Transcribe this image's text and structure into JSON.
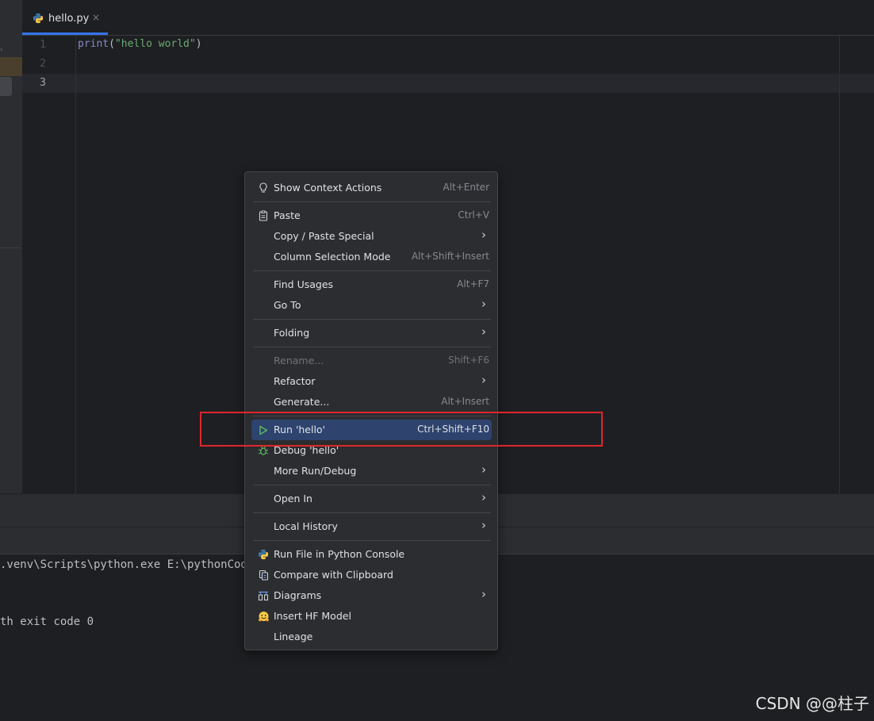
{
  "tab": {
    "filename": "hello.py",
    "close_glyph": "×"
  },
  "editor": {
    "line_numbers": [
      "1",
      "2",
      "3"
    ],
    "code": {
      "fn": "print",
      "open": "(",
      "str": "\"hello world\"",
      "close": ")"
    }
  },
  "console": {
    "line1": ".venv\\Scripts\\python.exe E:\\pythonCode",
    "line2": "th exit code 0"
  },
  "context_menu": {
    "items": [
      {
        "label": "Show Context Actions",
        "shortcut": "Alt+Enter",
        "icon": "lightbulb-icon"
      },
      {
        "label": "Paste",
        "shortcut": "Ctrl+V",
        "icon": "clipboard-icon"
      },
      {
        "label": "Copy / Paste Special",
        "shortcut": "",
        "submenu": true
      },
      {
        "label": "Column Selection Mode",
        "shortcut": "Alt+Shift+Insert"
      },
      {
        "label": "Find Usages",
        "shortcut": "Alt+F7"
      },
      {
        "label": "Go To",
        "shortcut": "",
        "submenu": true
      },
      {
        "label": "Folding",
        "shortcut": "",
        "submenu": true
      },
      {
        "label": "Rename...",
        "shortcut": "Shift+F6",
        "disabled": true
      },
      {
        "label": "Refactor",
        "shortcut": "",
        "submenu": true
      },
      {
        "label": "Generate...",
        "shortcut": "Alt+Insert"
      },
      {
        "label": "Run 'hello'",
        "shortcut": "Ctrl+Shift+F10",
        "icon": "run-icon",
        "highlighted": true
      },
      {
        "label": "Debug 'hello'",
        "shortcut": "",
        "icon": "debug-icon"
      },
      {
        "label": "More Run/Debug",
        "shortcut": "",
        "submenu": true
      },
      {
        "label": "Open In",
        "shortcut": "",
        "submenu": true
      },
      {
        "label": "Local History",
        "shortcut": "",
        "submenu": true
      },
      {
        "label": "Run File in Python Console",
        "shortcut": "",
        "icon": "python-icon"
      },
      {
        "label": "Compare with Clipboard",
        "shortcut": "",
        "icon": "compare-icon"
      },
      {
        "label": "Diagrams",
        "shortcut": "",
        "icon": "diagram-icon",
        "submenu": true
      },
      {
        "label": "Insert HF Model",
        "shortcut": "",
        "icon": "huggingface-icon"
      },
      {
        "label": "Lineage",
        "shortcut": ""
      }
    ],
    "submenu_glyph": "›"
  },
  "watermark": "CSDN @@柱子",
  "colors": {
    "accent": "#3574f0",
    "highlight": "#2e436e",
    "annotation_box": "#e0262b"
  }
}
